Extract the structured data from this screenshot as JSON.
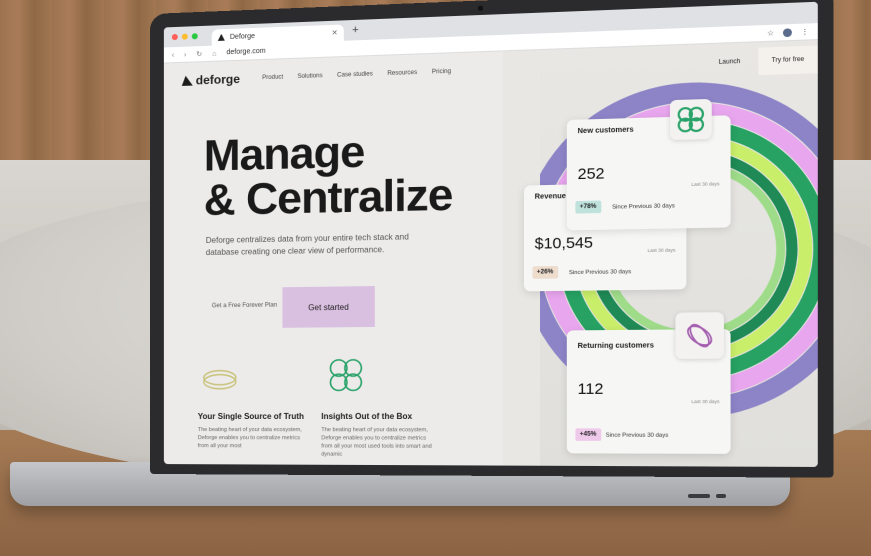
{
  "browser": {
    "tab_title": "Deforge",
    "tab_close": "✕",
    "new_tab": "+",
    "url": "deforge.com",
    "nav_icons": "‹ › ↻ ⌂",
    "star": "☆",
    "menu": "⋮"
  },
  "site": {
    "brand": "deforge",
    "nav": [
      "Product",
      "Solutions",
      "Case studies",
      "Resources",
      "Pricing"
    ],
    "launch": "Launch",
    "try_free": "Try for free",
    "hero_title_line1": "Manage",
    "hero_title_line2": "& Centralize",
    "hero_subtitle": "Deforge centralizes data from your entire tech stack and database creating one clear view of performance.",
    "plan_link": "Get a Free Forever Plan",
    "cta": "Get started",
    "features": [
      {
        "title": "Your Single Source of Truth",
        "text": "The beating heart of your data ecosystem, Deforge enables you to centralize metrics from all your most"
      },
      {
        "title": "Insights Out of the Box",
        "text": "The beating heart of your data ecosystem, Deforge enables you to centralize metrics from all your most used tools into smart and dynamic"
      }
    ]
  },
  "cards": {
    "new_customers": {
      "title": "New customers",
      "value": "252",
      "period": "Last 30 days",
      "delta": "+78%",
      "since": "Since Previous 30 days"
    },
    "revenue": {
      "title": "Revenue",
      "value": "$10,545",
      "period": "Last 30 days",
      "delta": "+26%",
      "since": "Since Previous 30 days"
    },
    "returning": {
      "title": "Returning customers",
      "value": "112",
      "period": "Last 30 days",
      "delta": "+45%",
      "since": "Since Previous 30 days"
    }
  },
  "colors": {
    "cta": "#d9bfe0",
    "delta_teal": "#bfe3dc",
    "delta_peach": "#eedccd",
    "delta_pink": "#efc9ea",
    "ring_green": "#27a263",
    "ring_lime": "#c9ee6a",
    "ring_purple": "#8d84c8",
    "ring_pink": "#e8a6ee"
  }
}
